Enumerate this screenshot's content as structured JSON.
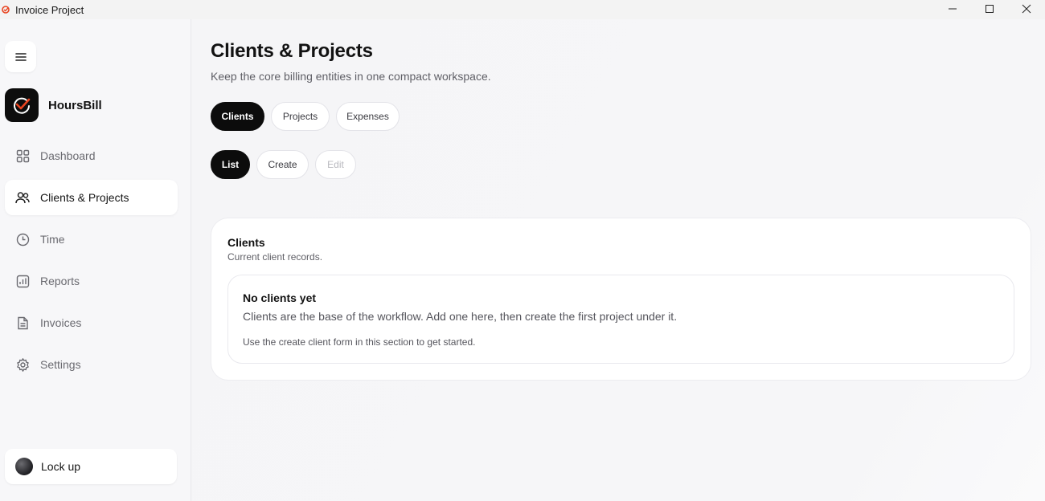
{
  "window": {
    "title": "Invoice Project",
    "controls": [
      "minimize-icon",
      "maximize-icon",
      "close-icon"
    ]
  },
  "sidebar": {
    "menu_icon": "hamburger-icon",
    "brand": {
      "name": "HoursBill",
      "logo_icon": "check-clock-icon",
      "accent": "#e8431f"
    },
    "items": [
      {
        "label": "Dashboard",
        "icon": "grid-icon",
        "active": false
      },
      {
        "label": "Clients & Projects",
        "icon": "users-icon",
        "active": true
      },
      {
        "label": "Time",
        "icon": "clock-icon",
        "active": false
      },
      {
        "label": "Reports",
        "icon": "chart-icon",
        "active": false
      },
      {
        "label": "Invoices",
        "icon": "document-icon",
        "active": false
      },
      {
        "label": "Settings",
        "icon": "gear-icon",
        "active": false
      }
    ],
    "lock_label": "Lock up"
  },
  "main": {
    "title": "Clients & Projects",
    "subtitle": "Keep the core billing entities in one compact workspace.",
    "entity_tabs": [
      {
        "label": "Clients",
        "active": true
      },
      {
        "label": "Projects",
        "active": false
      },
      {
        "label": "Expenses",
        "active": false
      }
    ],
    "mode_tabs": [
      {
        "label": "List",
        "active": true,
        "disabled": false
      },
      {
        "label": "Create",
        "active": false,
        "disabled": false
      },
      {
        "label": "Edit",
        "active": false,
        "disabled": true
      }
    ],
    "card": {
      "title": "Clients",
      "subtitle": "Current client records.",
      "empty_title": "No clients yet",
      "empty_desc": "Clients are the base of the workflow. Add one here, then create the first project under it.",
      "empty_hint": "Use the create client form in this section to get started."
    }
  },
  "colors": {
    "accent": "#e8431f",
    "active_pill": "#0c0c0c",
    "background": "#f4f4f6"
  }
}
